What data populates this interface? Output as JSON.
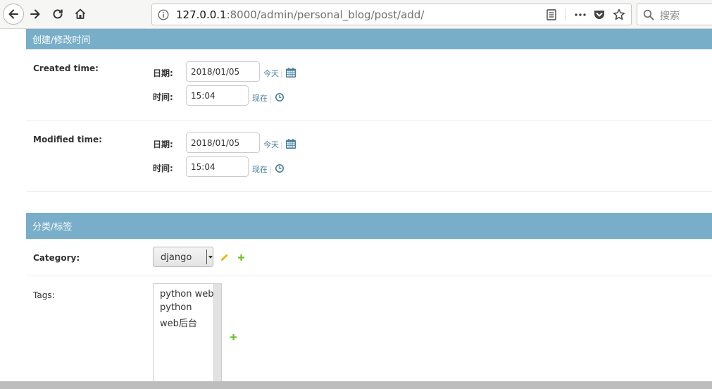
{
  "browser": {
    "url_host": "127.0.0.1",
    "url_rest": ":8000/admin/personal_blog/post/add/",
    "search_placeholder": "搜索"
  },
  "section_time": {
    "caption": "创建/修改时间",
    "created": {
      "label": "Created time:",
      "date_label": "日期:",
      "date_value": "2018/01/05",
      "today_link": "今天",
      "time_label": "时间:",
      "time_value": "15:04",
      "now_link": "现在"
    },
    "modified": {
      "label": "Modified time:",
      "date_label": "日期:",
      "date_value": "2018/01/05",
      "today_link": "今天",
      "time_label": "时间:",
      "time_value": "15:04",
      "now_link": "现在"
    }
  },
  "section_category": {
    "caption": "分类/标签",
    "category_label": "Category:",
    "category_selected": "django",
    "tags_label": "Tags:",
    "tags_options": [
      "python web",
      "python",
      "web后台"
    ]
  },
  "colors": {
    "caption_bg": "#79aec8",
    "link": "#447e9b",
    "add_green": "#70bf2b",
    "edit_yellow": "#efb80b"
  },
  "icons": [
    "back-icon",
    "forward-icon",
    "reload-icon",
    "home-icon",
    "info-icon",
    "reader-icon",
    "more-icon",
    "pocket-icon",
    "star-icon",
    "search-icon",
    "calendar-icon",
    "clock-icon",
    "edit-icon",
    "add-icon"
  ]
}
